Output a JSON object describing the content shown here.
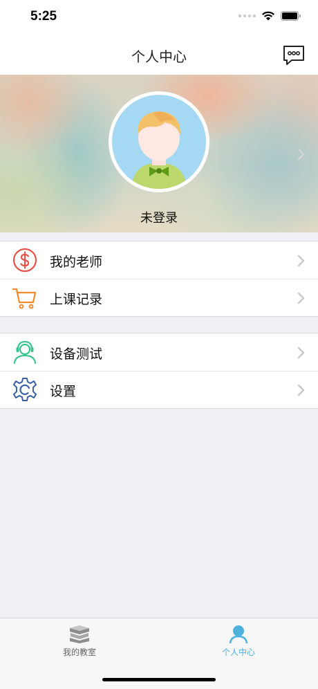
{
  "status_bar": {
    "time": "5:25"
  },
  "nav": {
    "title": "个人中心",
    "message_icon": "message-bubble-icon"
  },
  "profile": {
    "login_status": "未登录",
    "avatar_icon": "boy-avatar"
  },
  "menu_groups": [
    {
      "items": [
        {
          "label": "我的老师",
          "icon": "dollar-circle-icon",
          "color": "#e8524a"
        },
        {
          "label": "上课记录",
          "icon": "cart-icon",
          "color": "#f08a2a"
        }
      ]
    },
    {
      "items": [
        {
          "label": "设备测试",
          "icon": "headset-user-icon",
          "color": "#3cc48e"
        },
        {
          "label": "设置",
          "icon": "gear-icon",
          "color": "#3a5ea8"
        }
      ]
    }
  ],
  "tab_bar": {
    "tabs": [
      {
        "label": "我的教室",
        "icon": "books-icon",
        "active": false
      },
      {
        "label": "个人中心",
        "icon": "person-icon",
        "active": true
      }
    ]
  },
  "colors": {
    "accent": "#4ab2dd",
    "background": "#efeff4",
    "chevron": "#c7c7cc"
  }
}
